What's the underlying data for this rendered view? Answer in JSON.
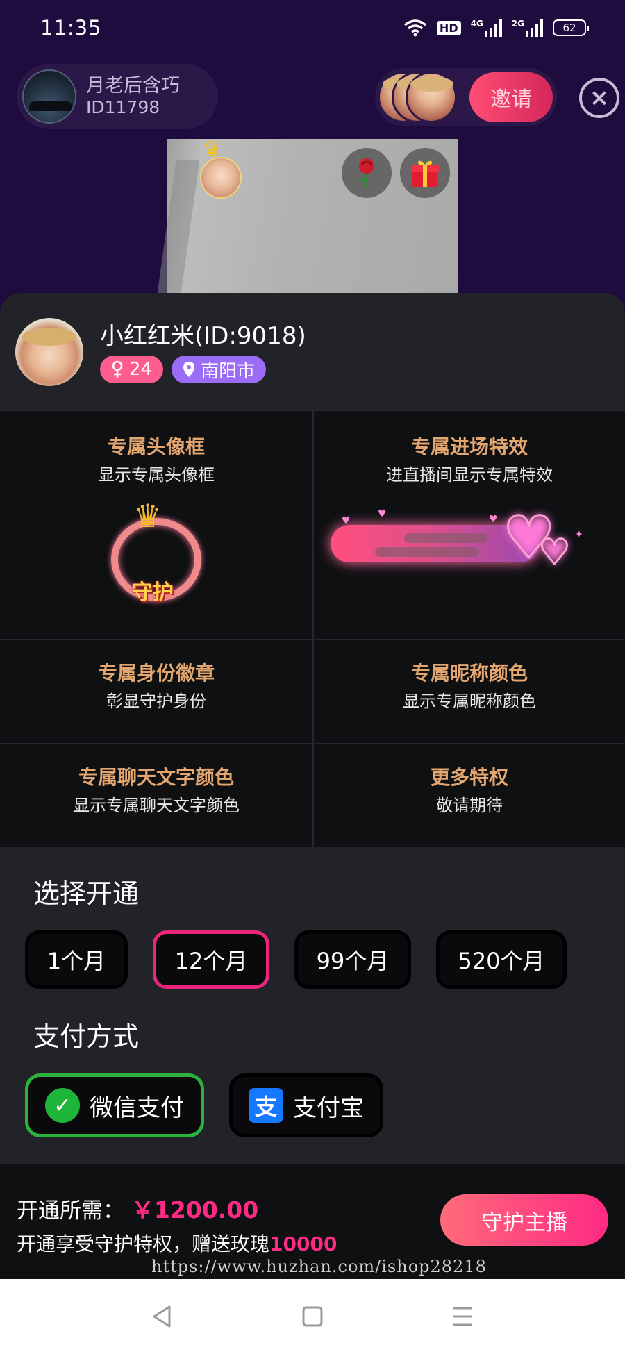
{
  "status_bar": {
    "time": "11:35",
    "hd": "HD",
    "net1": "4G",
    "net2": "2G",
    "battery": "62"
  },
  "host": {
    "name": "月老后含巧",
    "id": "ID11798",
    "avatar_icon": "car-photo-icon"
  },
  "header": {
    "invite_label": "邀请",
    "close_icon": "close-icon"
  },
  "video": {
    "rose_icon": "rose-icon",
    "gift_icon": "gift-icon",
    "crown_icon": "crown-icon"
  },
  "anchor": {
    "name": "小红红米(ID:9018)",
    "gender_icon": "female-icon",
    "age": "24",
    "city": "南阳市"
  },
  "privileges": [
    {
      "title": "专属头像框",
      "desc": "显示专属头像框",
      "art_label": "守护"
    },
    {
      "title": "专属进场特效",
      "desc": "进直播间显示专属特效"
    },
    {
      "title": "专属身份徽章",
      "desc": "彰显守护身份"
    },
    {
      "title": "专属昵称颜色",
      "desc": "显示专属昵称颜色"
    },
    {
      "title": "专属聊天文字颜色",
      "desc": "显示专属聊天文字颜色"
    },
    {
      "title": "更多特权",
      "desc": "敬请期待"
    }
  ],
  "duration": {
    "title": "选择开通",
    "options": [
      "1个月",
      "12个月",
      "99个月",
      "520个月"
    ],
    "selected": "12个月"
  },
  "payment": {
    "title": "支付方式",
    "methods": [
      "微信支付",
      "支付宝"
    ],
    "selected": "微信支付"
  },
  "footer": {
    "cost_label": "开通所需：",
    "price": "￥1200.00",
    "bonus_text": "开通享受守护特权，赠送玫瑰",
    "rose_count": "10000",
    "guard_button": "守护主播"
  },
  "watermark": "https://www.huzhan.com/ishop28218",
  "colors": {
    "accent": "#ff2a84",
    "gold": "#e3a66f",
    "wechat": "#2bb13c",
    "alipay": "#1677ff"
  }
}
